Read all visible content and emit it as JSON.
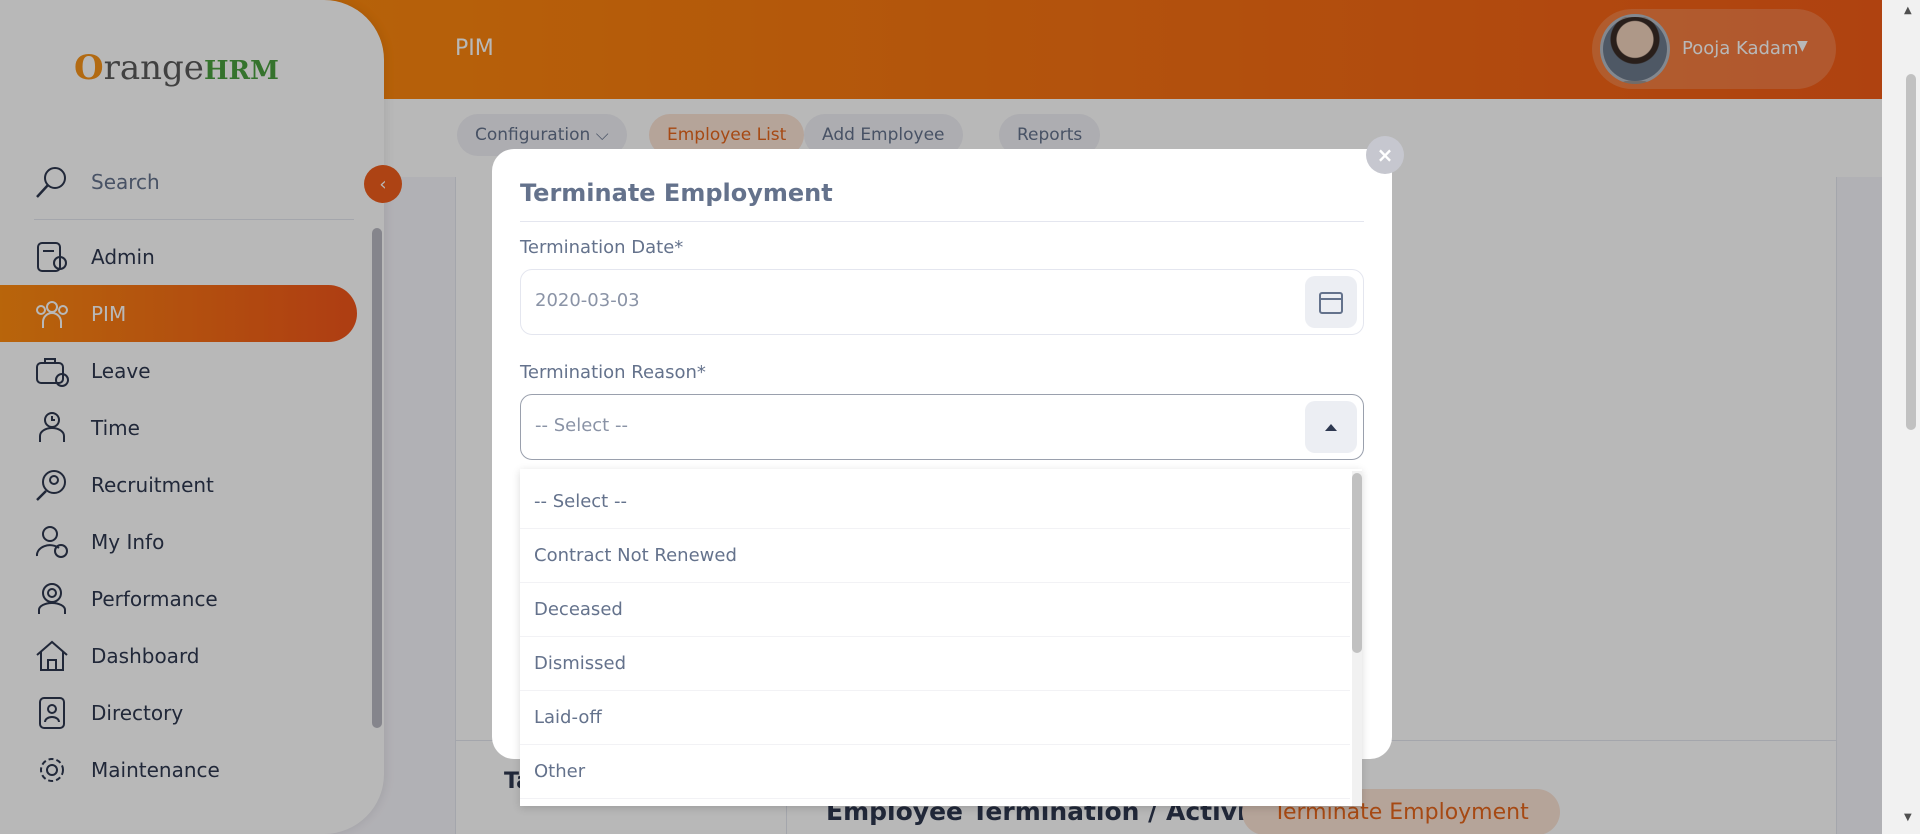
{
  "header": {
    "module_title": "PIM",
    "user_name": "Pooja Kadam",
    "user_caret": "▼"
  },
  "sidebar": {
    "logo_o": "O",
    "logo_range": "range",
    "logo_hrm": "HRM",
    "collapse_icon": "‹",
    "items": [
      {
        "label": "Search",
        "icon": "search-icon"
      },
      {
        "label": "Admin",
        "icon": "admin-icon"
      },
      {
        "label": "PIM",
        "icon": "pim-icon",
        "active": true
      },
      {
        "label": "Leave",
        "icon": "leave-icon"
      },
      {
        "label": "Time",
        "icon": "time-icon"
      },
      {
        "label": "Recruitment",
        "icon": "recruitment-icon"
      },
      {
        "label": "My Info",
        "icon": "my-info-icon"
      },
      {
        "label": "Performance",
        "icon": "performance-icon"
      },
      {
        "label": "Dashboard",
        "icon": "dashboard-icon"
      },
      {
        "label": "Directory",
        "icon": "directory-icon"
      },
      {
        "label": "Maintenance",
        "icon": "maintenance-icon"
      }
    ]
  },
  "subnav": {
    "configuration": "Configuration ⌵",
    "employee_list": "Employee List",
    "add_employee": "Add Employee",
    "reports": "Reports"
  },
  "page": {
    "left_heading": "Ta",
    "section_title": "Employee Termination / Activiation",
    "terminate_button": "Terminate Employment"
  },
  "modal": {
    "title": "Terminate Employment",
    "close": "×",
    "termination_date_label": "Termination Date*",
    "termination_date_value": "2020-03-03",
    "termination_reason_label": "Termination Reason*",
    "termination_reason_value": "-- Select --",
    "reason_options": [
      "-- Select --",
      "Contract Not Renewed",
      "Deceased",
      "Dismissed",
      "Laid-off",
      "Other"
    ]
  },
  "colors": {
    "brand_orange": "#f35c17",
    "accent_light": "#fbe3d5",
    "text_muted": "#64728c"
  }
}
